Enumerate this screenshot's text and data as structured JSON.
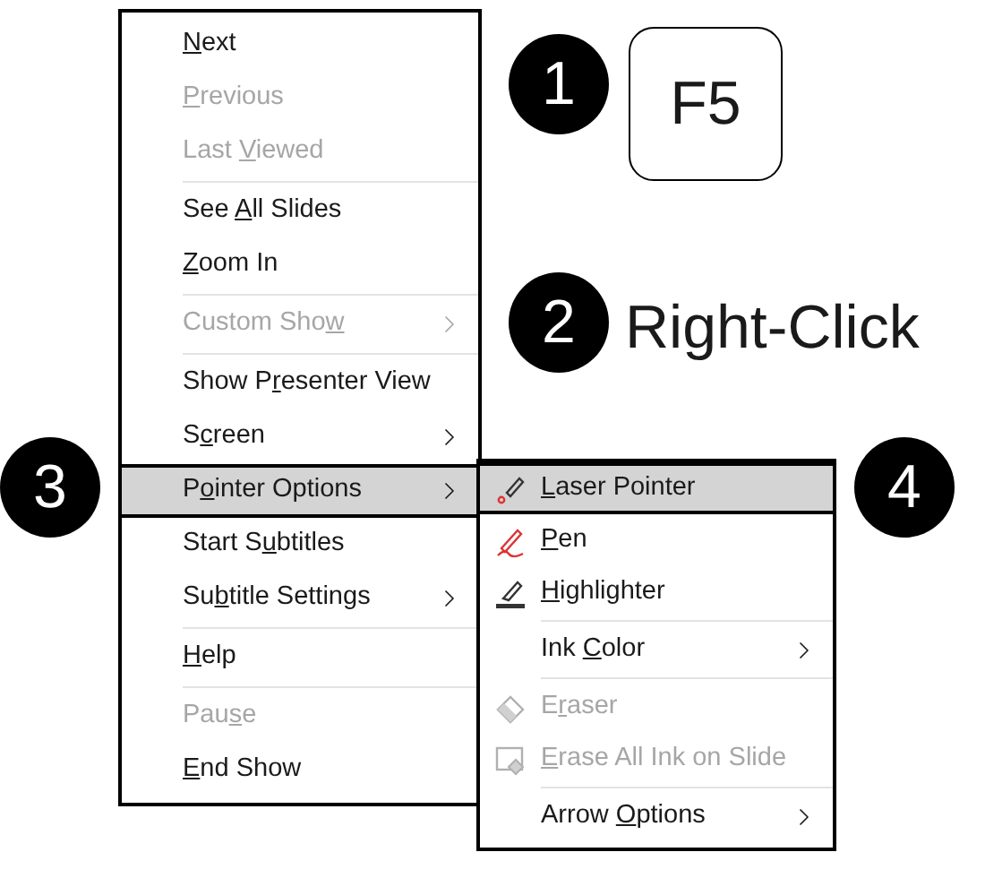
{
  "main_menu": {
    "items": [
      {
        "label": {
          "key": "N",
          "after": "ext"
        },
        "disabled": false,
        "submenu": false,
        "selected": false,
        "separator_before": false
      },
      {
        "label": {
          "key": "P",
          "after": "revious"
        },
        "disabled": true,
        "submenu": false,
        "selected": false,
        "separator_before": false
      },
      {
        "label": {
          "before": "Last ",
          "key": "V",
          "after": "iewed"
        },
        "disabled": true,
        "submenu": false,
        "selected": false,
        "separator_before": false
      },
      {
        "label": {
          "before": "See ",
          "key": "A",
          "after": "ll Slides"
        },
        "disabled": false,
        "submenu": false,
        "selected": false,
        "separator_before": true
      },
      {
        "label": {
          "key": "Z",
          "after": "oom In"
        },
        "disabled": false,
        "submenu": false,
        "selected": false,
        "separator_before": false
      },
      {
        "label": {
          "before": "Custom Sho",
          "key": "w"
        },
        "disabled": true,
        "submenu": true,
        "selected": false,
        "separator_before": true
      },
      {
        "label": {
          "before": "Show P",
          "key": "r",
          "after": "esenter View"
        },
        "disabled": false,
        "submenu": false,
        "selected": false,
        "separator_before": true
      },
      {
        "label": {
          "before": "S",
          "key": "c",
          "after": "reen"
        },
        "disabled": false,
        "submenu": true,
        "selected": false,
        "separator_before": false
      },
      {
        "label": {
          "before": "P",
          "key": "o",
          "after": "inter Options"
        },
        "disabled": false,
        "submenu": true,
        "selected": true,
        "separator_before": false
      },
      {
        "label": {
          "before": "Start S",
          "key": "u",
          "after": "btitles"
        },
        "disabled": false,
        "submenu": false,
        "selected": false,
        "separator_before": false
      },
      {
        "label": {
          "before": "Su",
          "key": "b",
          "after": "title Settings"
        },
        "disabled": false,
        "submenu": true,
        "selected": false,
        "separator_before": false
      },
      {
        "label": {
          "key": "H",
          "after": "elp"
        },
        "disabled": false,
        "submenu": false,
        "selected": false,
        "separator_before": true
      },
      {
        "label": {
          "before": "Pau",
          "key": "s",
          "after": "e"
        },
        "disabled": true,
        "submenu": false,
        "selected": false,
        "separator_before": true
      },
      {
        "label": {
          "key": "E",
          "after": "nd Show"
        },
        "disabled": false,
        "submenu": false,
        "selected": false,
        "separator_before": false
      }
    ]
  },
  "submenu": {
    "items": [
      {
        "kind": "laser",
        "label": {
          "key": "L",
          "after": "aser Pointer"
        },
        "disabled": false,
        "submenu": false,
        "selected": true,
        "separator_before": false
      },
      {
        "kind": "pen",
        "label": {
          "key": "P",
          "after": "en"
        },
        "disabled": false,
        "submenu": false,
        "selected": false,
        "separator_before": false
      },
      {
        "kind": "highlighter",
        "label": {
          "key": "H",
          "after": "ighlighter"
        },
        "disabled": false,
        "submenu": false,
        "selected": false,
        "separator_before": false
      },
      {
        "kind": "plain",
        "label": {
          "before": "Ink ",
          "key": "C",
          "after": "olor"
        },
        "disabled": false,
        "submenu": true,
        "selected": false,
        "separator_before": true
      },
      {
        "kind": "eraser",
        "label": {
          "before": "E",
          "key": "r",
          "after": "aser"
        },
        "disabled": true,
        "submenu": false,
        "selected": false,
        "separator_before": true
      },
      {
        "kind": "erase-all",
        "label": {
          "key": "E",
          "after": "rase All Ink on Slide"
        },
        "disabled": true,
        "submenu": false,
        "selected": false,
        "separator_before": false
      },
      {
        "kind": "plain",
        "label": {
          "before": "Arrow ",
          "key": "O",
          "after": "ptions"
        },
        "disabled": false,
        "submenu": true,
        "selected": false,
        "separator_before": true
      }
    ]
  },
  "callouts": [
    {
      "number": "1",
      "kind": "key",
      "text": "F5"
    },
    {
      "number": "2",
      "kind": "caption",
      "text": "Right-Click"
    },
    {
      "number": "3",
      "kind": "marker"
    },
    {
      "number": "4",
      "kind": "marker"
    }
  ]
}
